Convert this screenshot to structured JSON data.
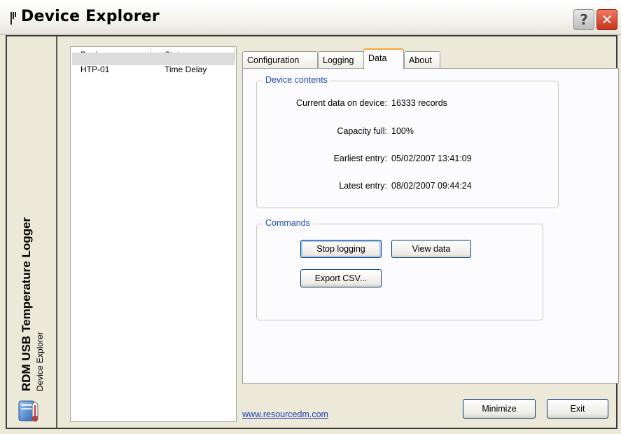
{
  "window": {
    "title": "Device Explorer",
    "help_glyph": "?",
    "close_glyph": "✕",
    "icons": {
      "title": "flag-icon",
      "help": "help-icon",
      "close": "close-icon",
      "app": "computer-thermometer-icon"
    }
  },
  "sidebar": {
    "title": "RDM USB Temperature Logger",
    "subtitle": "Device Explorer"
  },
  "device_list": {
    "columns": [
      "Device",
      "Status"
    ],
    "rows": [
      {
        "device": "HTP-01",
        "status": "Time Delay"
      }
    ]
  },
  "tabs": [
    {
      "label": "Configuration",
      "active": false
    },
    {
      "label": "Logging",
      "active": false
    },
    {
      "label": "Data",
      "active": true
    },
    {
      "label": "About",
      "active": false
    }
  ],
  "device_contents": {
    "legend": "Device contents",
    "fields": [
      {
        "label": "Current data on device:",
        "value": "16333 records"
      },
      {
        "label": "Capacity full:",
        "value": "100%"
      },
      {
        "label": "Earliest entry:",
        "value": "05/02/2007 13:41:09"
      },
      {
        "label": "Latest entry:",
        "value": "08/02/2007 09:44:24"
      }
    ]
  },
  "commands": {
    "legend": "Commands",
    "stop_logging": "Stop logging",
    "view_data": "View data",
    "export_csv": "Export CSV..."
  },
  "footer": {
    "link": "www.resourcedm.com",
    "minimize": "Minimize",
    "exit": "Exit"
  },
  "colors": {
    "accent_tab": "#f0a930",
    "group_label": "#1b4ab0",
    "close_button": "#c9321b"
  }
}
